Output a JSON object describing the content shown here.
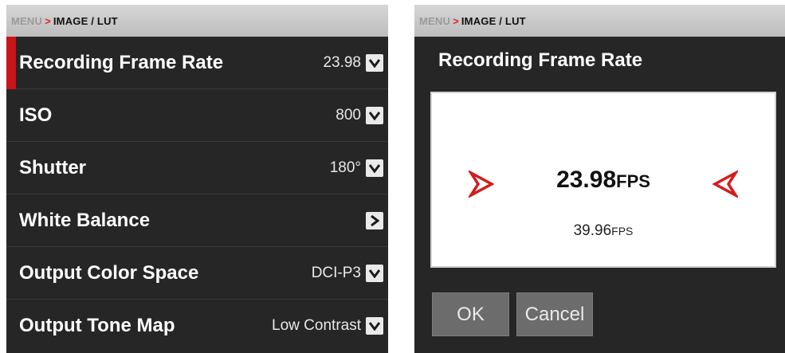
{
  "breadcrumb": {
    "menu": "MENU",
    "separator": ">",
    "path": "IMAGE / LUT"
  },
  "settings": [
    {
      "label": "Recording Frame Rate",
      "value": "23.98",
      "control": "chevron-down"
    },
    {
      "label": "ISO",
      "value": "800",
      "control": "chevron-down"
    },
    {
      "label": "Shutter",
      "value": "180°",
      "control": "chevron-down"
    },
    {
      "label": "White Balance",
      "value": "",
      "control": "chevron-right"
    },
    {
      "label": "Output Color Space",
      "value": "DCI-P3",
      "control": "chevron-down"
    },
    {
      "label": "Output Tone Map",
      "value": "Low Contrast",
      "control": "chevron-down"
    }
  ],
  "dialog": {
    "title": "Recording Frame Rate",
    "current_value": "23.98",
    "current_unit": "FPS",
    "next_value": "39.96",
    "next_unit": "FPS",
    "ok_label": "OK",
    "cancel_label": "Cancel"
  },
  "colors": {
    "accent": "#c8161a",
    "panel": "#262626",
    "header": "#c9c9c9"
  }
}
